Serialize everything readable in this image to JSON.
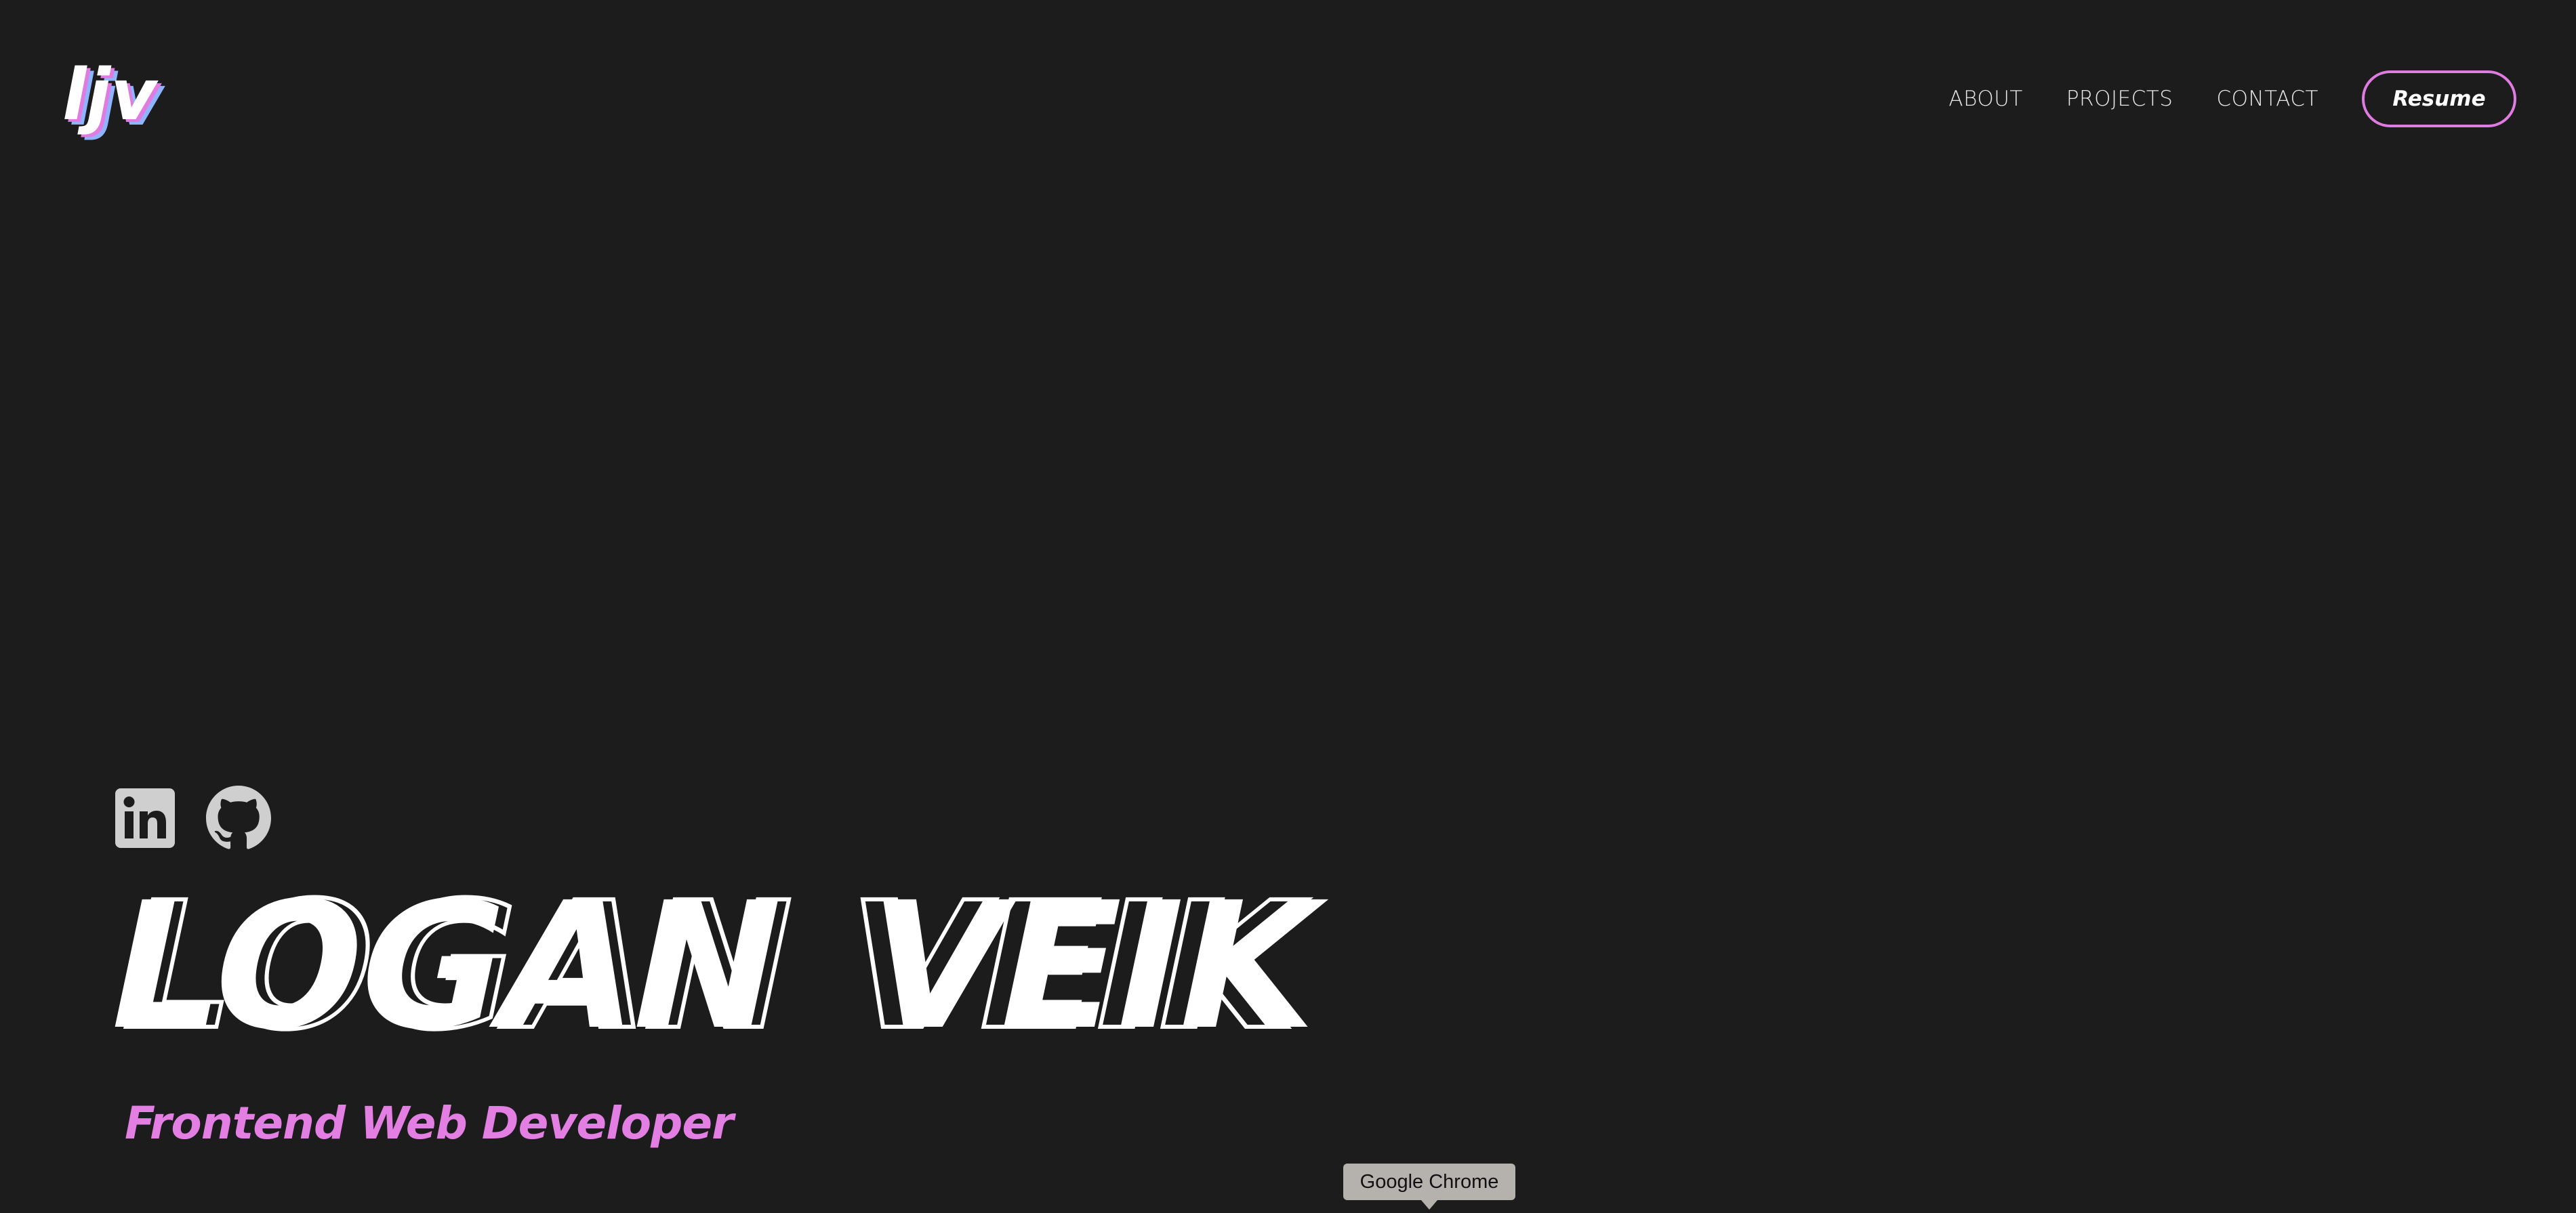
{
  "brand": {
    "logo_text": "ljv",
    "logo_colors": {
      "front": "#ffffff",
      "shadow_pink": "#e07be0",
      "shadow_blue": "#8fb4ff"
    }
  },
  "nav": {
    "items": [
      {
        "label": "ABOUT"
      },
      {
        "label": "PROJECTS"
      },
      {
        "label": "CONTACT"
      }
    ],
    "resume_label": "Resume"
  },
  "socials": [
    {
      "icon": "linkedin-icon"
    },
    {
      "icon": "github-icon"
    }
  ],
  "hero": {
    "first_name": "LOGAN",
    "last_name": "VEIK",
    "subtitle": "Frontend Web Developer"
  },
  "tooltip": {
    "text": "Google Chrome"
  },
  "colors": {
    "background": "#1c1c1d",
    "accent": "#e07be0",
    "text": "#ffffff",
    "icon": "#cfcfcf"
  }
}
